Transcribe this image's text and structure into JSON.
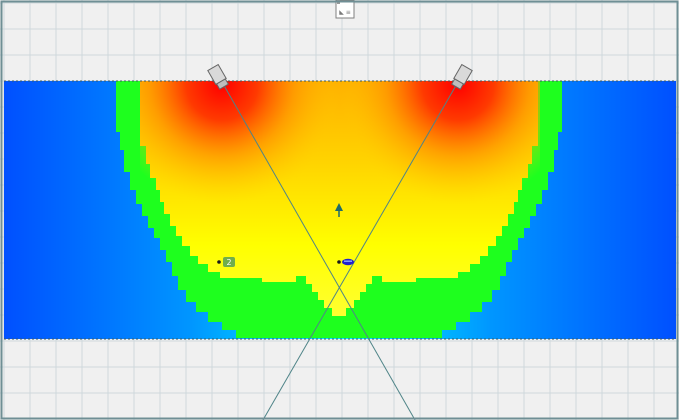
{
  "colors": {
    "canvas_background": "#f0f0f0",
    "grid_line": "#cfd8dc",
    "frame_border": "#6f8f95",
    "zone_boundary": "#3a5a60",
    "heat_deep_blue": "#0050ff",
    "heat_cyan": "#00f0ff",
    "heat_green": "#1eff1e",
    "heat_yellow": "#ffff00",
    "heat_orange": "#ff8000",
    "heat_red": "#ff0000",
    "sight_line": "#4f8488",
    "marker_teal": "#1e6b6b",
    "marker_blue": "#2222cc",
    "camera_fill": "#d9d9d9",
    "camera_stroke": "#666666"
  },
  "icons": {
    "top_widget": "top-center-widget-icon",
    "left_camera": "camera-icon",
    "right_camera": "camera-icon",
    "direction_marker": "arrow-up-icon",
    "blue_marker": "target-marker-icon",
    "numbered_marker": "numbered-marker-icon"
  },
  "markers": {
    "numbered_marker_label": "2",
    "top_widget_label": "◣ ≡"
  }
}
